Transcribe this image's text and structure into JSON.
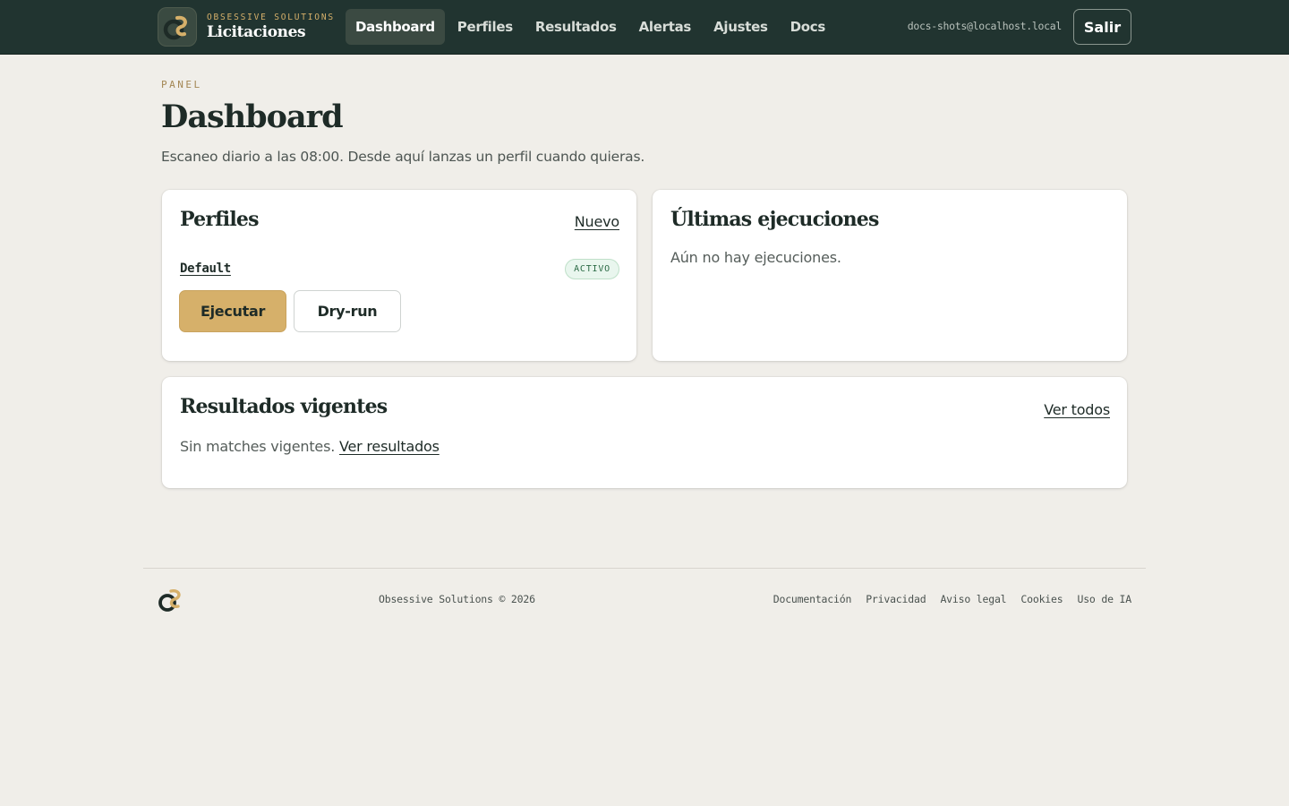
{
  "brand": {
    "kicker": "OBSESSIVE SOLUTIONS",
    "name": "Licitaciones",
    "logo_icon": "os-logo-icon",
    "accent": "#d6b06a",
    "topbar_bg": "#213430"
  },
  "nav": {
    "items": [
      {
        "label": "Dashboard",
        "active": true
      },
      {
        "label": "Perfiles",
        "active": false
      },
      {
        "label": "Resultados",
        "active": false
      },
      {
        "label": "Alertas",
        "active": false
      },
      {
        "label": "Ajustes",
        "active": false
      },
      {
        "label": "Docs",
        "active": false
      }
    ]
  },
  "user": {
    "email": "docs-shots@localhost.local",
    "logout_label": "Salir"
  },
  "header": {
    "kicker": "PANEL",
    "title": "Dashboard",
    "subtitle": "Escaneo diario a las 08:00. Desde aquí lanzas un perfil cuando quieras."
  },
  "profiles_card": {
    "title": "Perfiles",
    "new_label": "Nuevo",
    "profiles": [
      {
        "name": "Default",
        "status": "ACTIVO",
        "status_color": "#2b6a45"
      }
    ],
    "run_label": "Ejecutar",
    "dryrun_label": "Dry-run"
  },
  "runs_card": {
    "title": "Últimas ejecuciones",
    "empty_text": "Aún no hay ejecuciones."
  },
  "results_card": {
    "title": "Resultados vigentes",
    "view_all_label": "Ver todos",
    "empty_text": "Sin matches vigentes.",
    "view_results_label": "Ver resultados"
  },
  "footer": {
    "copyright": "Obsessive Solutions © 2026",
    "links": [
      "Documentación",
      "Privacidad",
      "Aviso legal",
      "Cookies",
      "Uso de IA"
    ]
  }
}
